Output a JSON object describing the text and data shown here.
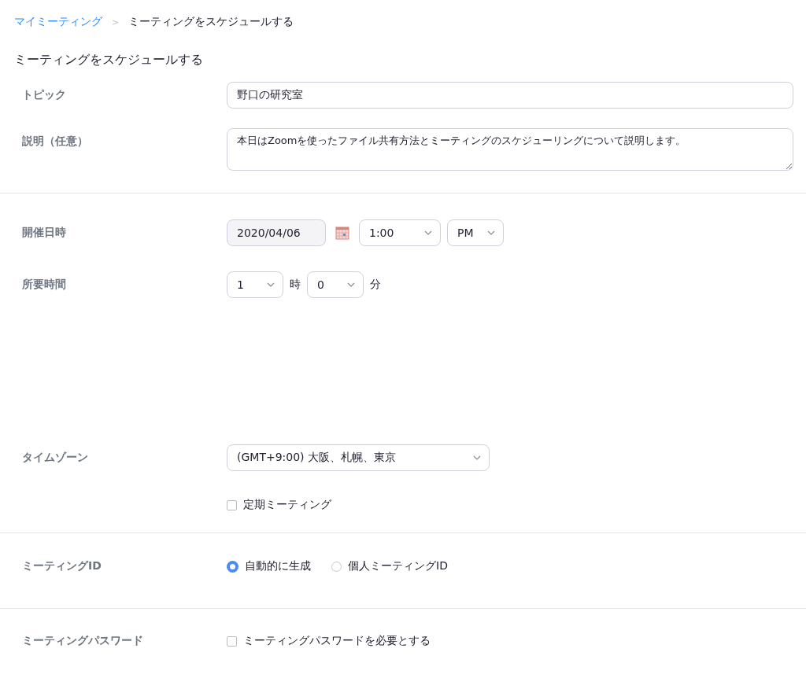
{
  "breadcrumb": {
    "link": "マイミーティング",
    "separator": ">",
    "current": "ミーティングをスケジュールする"
  },
  "heading": "ミーティングをスケジュールする",
  "sections": [
    {
      "rows": [
        {
          "kind": "text",
          "label": "トピック",
          "value": "野口の研究室"
        },
        {
          "kind": "textarea",
          "label": "説明（任意）",
          "value": "本日はZoomを使ったファイル共有方法とミーティングのスケジューリングについて説明します。"
        }
      ]
    },
    {
      "rows": [
        {
          "kind": "datetime",
          "label": "開催日時",
          "date": "2020/04/06",
          "time": "1:00",
          "ampm": "PM"
        },
        {
          "kind": "duration",
          "label": "所要時間",
          "hours": "1",
          "hours_unit": "時",
          "minutes": "0",
          "minutes_unit": "分"
        },
        {
          "kind": "select",
          "label": "タイムゾーン",
          "value": "(GMT+9:00) 大阪、札幌、東京"
        },
        {
          "kind": "checkbox",
          "label": "",
          "option": "定期ミーティング",
          "checked": false
        }
      ]
    },
    {
      "rows": [
        {
          "kind": "radio",
          "label": "ミーティングID",
          "options": [
            {
              "label": "自動的に生成",
              "selected": true
            },
            {
              "label": "個人ミーティングID",
              "selected": false
            }
          ]
        }
      ]
    },
    {
      "rows": [
        {
          "kind": "checkbox",
          "label": "ミーティングパスワード",
          "option": "ミーティングパスワードを必要とする",
          "checked": false
        }
      ]
    }
  ]
}
